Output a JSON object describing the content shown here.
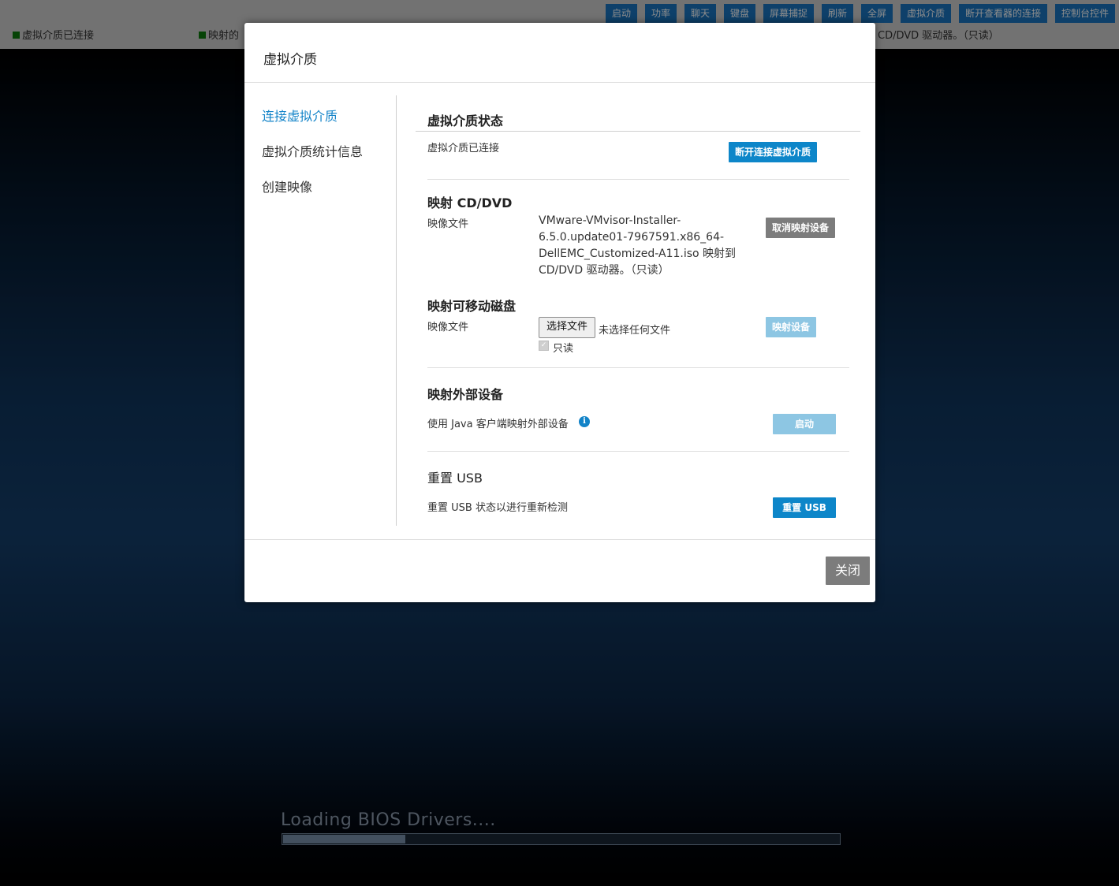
{
  "toolbar": {
    "buttons": [
      {
        "label": "启动"
      },
      {
        "label": "功率"
      },
      {
        "label": "聊天"
      },
      {
        "label": "键盘"
      },
      {
        "label": "屏幕捕捉"
      },
      {
        "label": "刷新"
      },
      {
        "label": "全屏"
      },
      {
        "label": "虚拟介质"
      },
      {
        "label": "断开查看器的连接"
      },
      {
        "label": "控制台控件"
      }
    ]
  },
  "status": {
    "left": "虚拟介质已连接",
    "middle": "映射的",
    "right": "CD/DVD 驱动器。（只读）",
    "indicator_color": "#0b7a0b"
  },
  "console": {
    "bios_text": "Loading BIOS Drivers....",
    "progress": 0.22
  },
  "modal": {
    "title": "虚拟介质",
    "nav": [
      {
        "label": "连接虚拟介质",
        "active": true
      },
      {
        "label": "虚拟介质统计信息",
        "active": false
      },
      {
        "label": "创建映像",
        "active": false
      }
    ],
    "status_section": {
      "title": "虚拟介质状态",
      "status_text": "虚拟介质已连接",
      "disconnect_label": "断开连接虚拟介质"
    },
    "cd_section": {
      "title": "映射 CD/DVD",
      "file_label": "映像文件",
      "file_value": "VMware-VMvisor-Installer-6.5.0.update01-7967591.x86_64-DellEMC_Customized-A11.iso 映射到 CD/DVD 驱动器。（只读）",
      "unmap_label": "取消映射设备"
    },
    "removable_section": {
      "title": "映射可移动磁盘",
      "file_label": "映像文件",
      "choose_label": "选择文件",
      "no_file_text": "未选择任何文件",
      "readonly_label": "只读",
      "readonly_checked": true,
      "map_label": "映射设备"
    },
    "external_section": {
      "title": "映射外部设备",
      "desc": "使用 Java 客户端映射外部设备",
      "info_icon": "i",
      "launch_label": "启动"
    },
    "usb_section": {
      "title": "重置 USB",
      "desc": "重置 USB 状态以进行重新检测",
      "reset_label": "重置 USB"
    },
    "close_label": "关闭"
  },
  "colors": {
    "accent": "#0d86c9",
    "toolbar_button": "#1b76c2",
    "disabled_button": "#8dc6e3",
    "gray_button": "#7c7c7c"
  }
}
